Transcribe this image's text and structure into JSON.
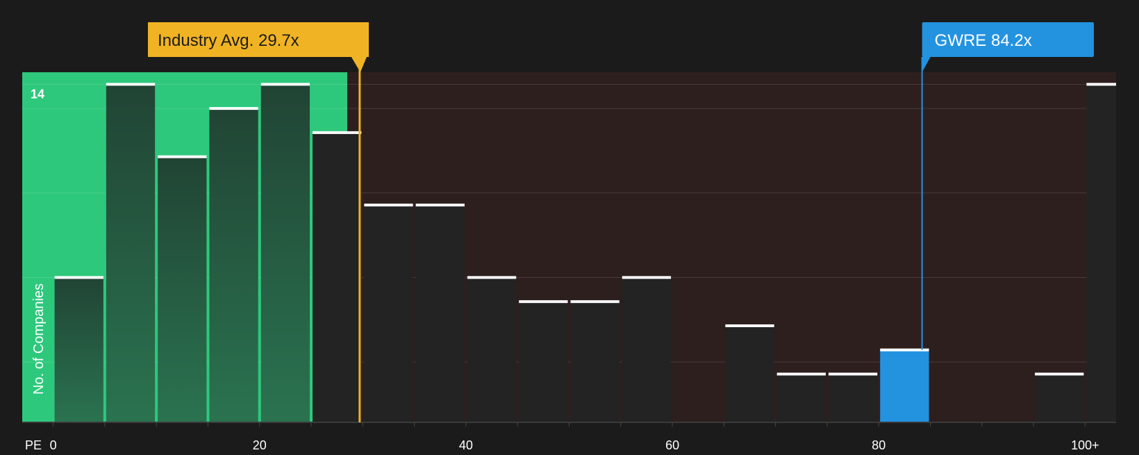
{
  "chart_data": {
    "type": "bar",
    "title": "",
    "xlabel": "PE",
    "ylabel": "No. of Companies",
    "xlim": [
      -3,
      103
    ],
    "ylim": [
      0,
      14.5
    ],
    "x_ticks": [
      {
        "value": 0,
        "label": "0"
      },
      {
        "value": 20,
        "label": "20"
      },
      {
        "value": 40,
        "label": "40"
      },
      {
        "value": 60,
        "label": "60"
      },
      {
        "value": 80,
        "label": "80"
      },
      {
        "value": 100,
        "label": "100+"
      }
    ],
    "y_ticks": [
      {
        "value": 14,
        "label": "14"
      }
    ],
    "grid": true,
    "bin_width": 5,
    "bins": [
      {
        "start": 0,
        "value": 6
      },
      {
        "start": 5,
        "value": 14
      },
      {
        "start": 10,
        "value": 11
      },
      {
        "start": 15,
        "value": 13
      },
      {
        "start": 20,
        "value": 14
      },
      {
        "start": 25,
        "value": 12
      },
      {
        "start": 30,
        "value": 9
      },
      {
        "start": 35,
        "value": 9
      },
      {
        "start": 40,
        "value": 6
      },
      {
        "start": 45,
        "value": 5
      },
      {
        "start": 50,
        "value": 5
      },
      {
        "start": 55,
        "value": 6
      },
      {
        "start": 60,
        "value": 0
      },
      {
        "start": 65,
        "value": 4
      },
      {
        "start": 70,
        "value": 2
      },
      {
        "start": 75,
        "value": 2
      },
      {
        "start": 80,
        "value": 3,
        "highlight": true
      },
      {
        "start": 85,
        "value": 0
      },
      {
        "start": 90,
        "value": 0
      },
      {
        "start": 95,
        "value": 2
      },
      {
        "start": 100,
        "value": 14
      }
    ],
    "fair_zone_end": 28.5,
    "industry_avg": {
      "value": 29.7,
      "label": "Industry Avg. 29.7x",
      "color": "#f0b323"
    },
    "company": {
      "value": 84.2,
      "label": "GWRE 84.2x",
      "color": "#2393e0"
    },
    "colors": {
      "background": "#1b1b1b",
      "fair_zone": "#2ec87c",
      "expensive_zone": "#2e1f1f",
      "bar_dark": "#232323",
      "bar_green_top": "#214434",
      "bar_green_bottom": "#2a7350",
      "bar_cap": "#ffffff",
      "highlight": "#2393e0"
    }
  }
}
